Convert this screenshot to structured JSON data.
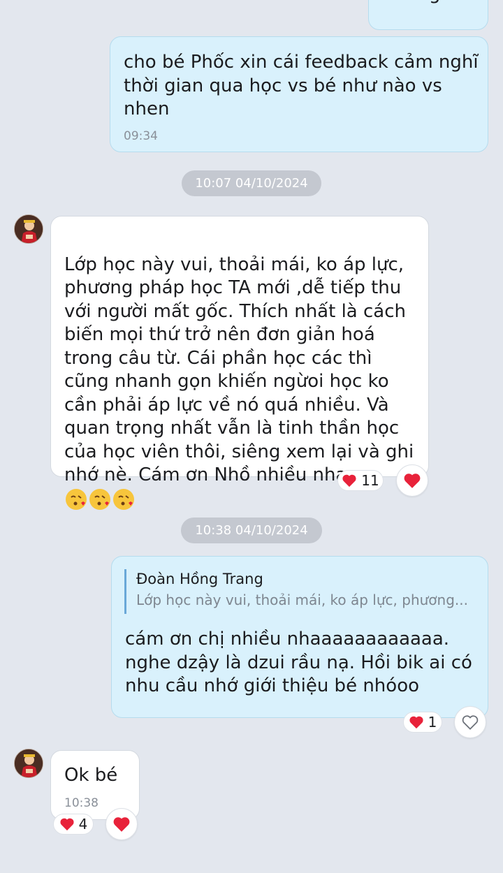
{
  "colors": {
    "background": "#e3e7ee",
    "my_bubble": "#d9f1fc",
    "their_bubble": "#ffffff",
    "heart": "#e8223a",
    "date_pill": "#c4c8d0"
  },
  "messages": [
    {
      "sender": "me",
      "text": "Chàng  ơiii"
    },
    {
      "sender": "me",
      "text": "cho bé Phốc xin cái feedback cảm nghĩ thời gian qua học vs bé như nào vs nhen",
      "time": "09:34"
    },
    {
      "sender": "them",
      "text": "Lớp học này vui, thoải mái, ko áp lực, phương pháp học TA mới ,dễ tiếp thu với người mất gốc. Thích nhất là cách biến mọi thứ trở nên đơn giản hoá trong câu từ. Cái phần học các thì cũng nhanh gọn khiến ngừoi học ko cần phải áp lực về nó quá nhiều. Và quan trọng nhất vẫn là tinh thần học của học viên thôi, siêng xem lại và ghi nhớ nè. Cám ơn Nhồ nhiều nha",
      "reaction_count": "11"
    },
    {
      "sender": "me",
      "reply_to_name": "Đoàn Hồng Trang",
      "reply_to_text": "Lớp học này vui, thoải mái, ko áp lực, phương...",
      "text": "cám ơn chị nhiều nhaaaaaaaaaaaa. nghe dzậy là dzui rầu nạ. Hồi bik ai có nhu cầu nhớ giới thiệu bé nhóoo",
      "reaction_count": "1"
    },
    {
      "sender": "them",
      "text": "Ok bé",
      "time": "10:38",
      "reaction_count": "4"
    }
  ],
  "date_separators": [
    "10:07 04/10/2024",
    "10:38 04/10/2024"
  ],
  "icons": {
    "reaction": "heart-icon",
    "reaction_empty": "heart-outline-icon",
    "emoji": "face-blowing-kiss-emoji"
  }
}
